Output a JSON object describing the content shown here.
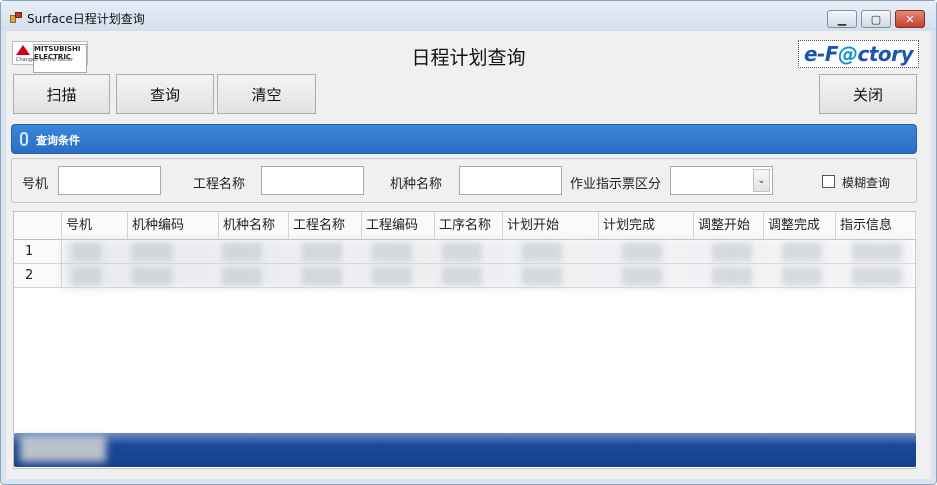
{
  "window": {
    "title": "Surface日程计划查询",
    "min_glyph": "▁",
    "max_glyph": "▢",
    "close_glyph": "✕"
  },
  "header": {
    "title": "日程计划查询",
    "logo_left_text": "MITSUBISHI ELECTRIC",
    "logo_left_tagline": "Changes for the Better",
    "logo_right_text_a": "e-F",
    "logo_right_text_b": "@",
    "logo_right_text_c": "ctory"
  },
  "toolbar": {
    "scan_label": "扫描",
    "query_label": "查询",
    "clear_label": "清空",
    "close_label": "关闭"
  },
  "criteria": {
    "group_label": "查询条件",
    "machine_no_label": "号机",
    "machine_no_value": "",
    "project_name_label": "工程名称",
    "project_name_value": "",
    "model_name_label": "机种名称",
    "model_name_value": "",
    "instruction_type_label": "作业指示票区分",
    "instruction_type_value": "",
    "fuzzy_label": "模糊查询",
    "fuzzy_checked": false
  },
  "grid": {
    "columns": [
      "号机",
      "机种编码",
      "机种名称",
      "工程名称",
      "工程编码",
      "工序名称",
      "计划开始",
      "计划完成",
      "调整开始",
      "调整完成",
      "指示信息"
    ],
    "rows": [
      {
        "index": "1"
      },
      {
        "index": "2"
      }
    ]
  },
  "colors": {
    "accent": "#2a6fc4",
    "status_bar": "#1e4ea0",
    "window_frame": "#d9e4f1"
  }
}
